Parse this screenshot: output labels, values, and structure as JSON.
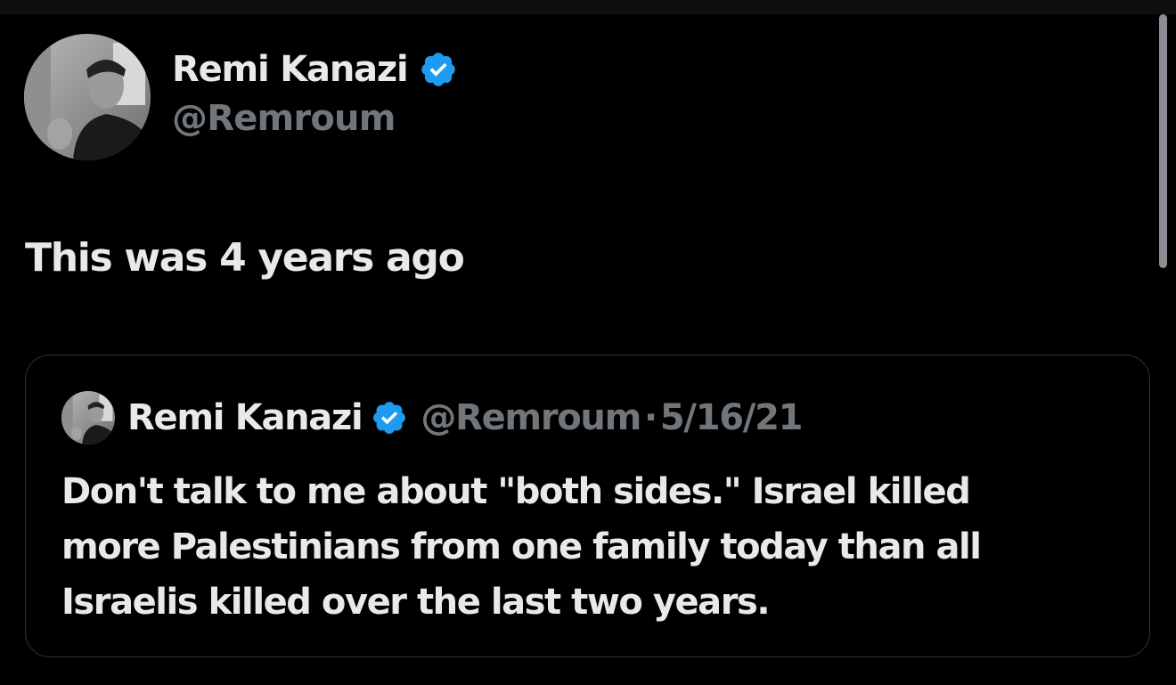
{
  "tweet": {
    "author": {
      "name": "Remi Kanazi",
      "handle": "@Remroum",
      "verified_icon": "verified-badge-icon",
      "avatar": "profile-photo"
    },
    "text": "This was 4 years ago"
  },
  "quoted_tweet": {
    "author": {
      "name": "Remi Kanazi",
      "handle": "@Remroum",
      "verified_icon": "verified-badge-icon",
      "avatar": "profile-photo"
    },
    "separator": "·",
    "date": "5/16/21",
    "text_lines": [
      "Don't talk to me about \"both sides.\" Israel killed",
      "more Palestinians from one family today than all",
      "Israelis killed over the last two years."
    ]
  },
  "colors": {
    "background": "#000000",
    "primary_text": "#e7e9ea",
    "secondary_text": "#71767b",
    "verified_blue": "#1d9bf0",
    "card_border": "#2f3336"
  }
}
